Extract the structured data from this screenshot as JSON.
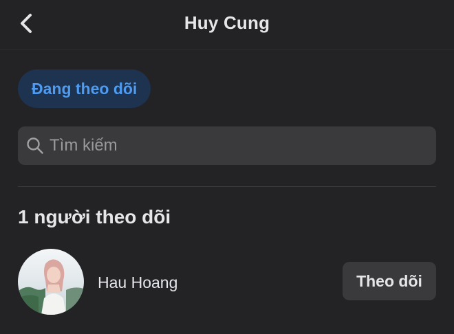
{
  "header": {
    "title": "Huy Cung",
    "back_icon": "chevron-left-icon"
  },
  "filter": {
    "active_label": "Đang theo dõi"
  },
  "search": {
    "placeholder": "Tìm kiếm",
    "icon": "search-icon"
  },
  "section": {
    "title": "1 người theo dõi"
  },
  "followers": [
    {
      "name": "Hau Hoang",
      "action_label": "Theo dõi"
    }
  ],
  "colors": {
    "background": "#232325",
    "accent": "#4f9bf0",
    "chip_background": "#1d3350",
    "surface": "#3a3a3c"
  }
}
